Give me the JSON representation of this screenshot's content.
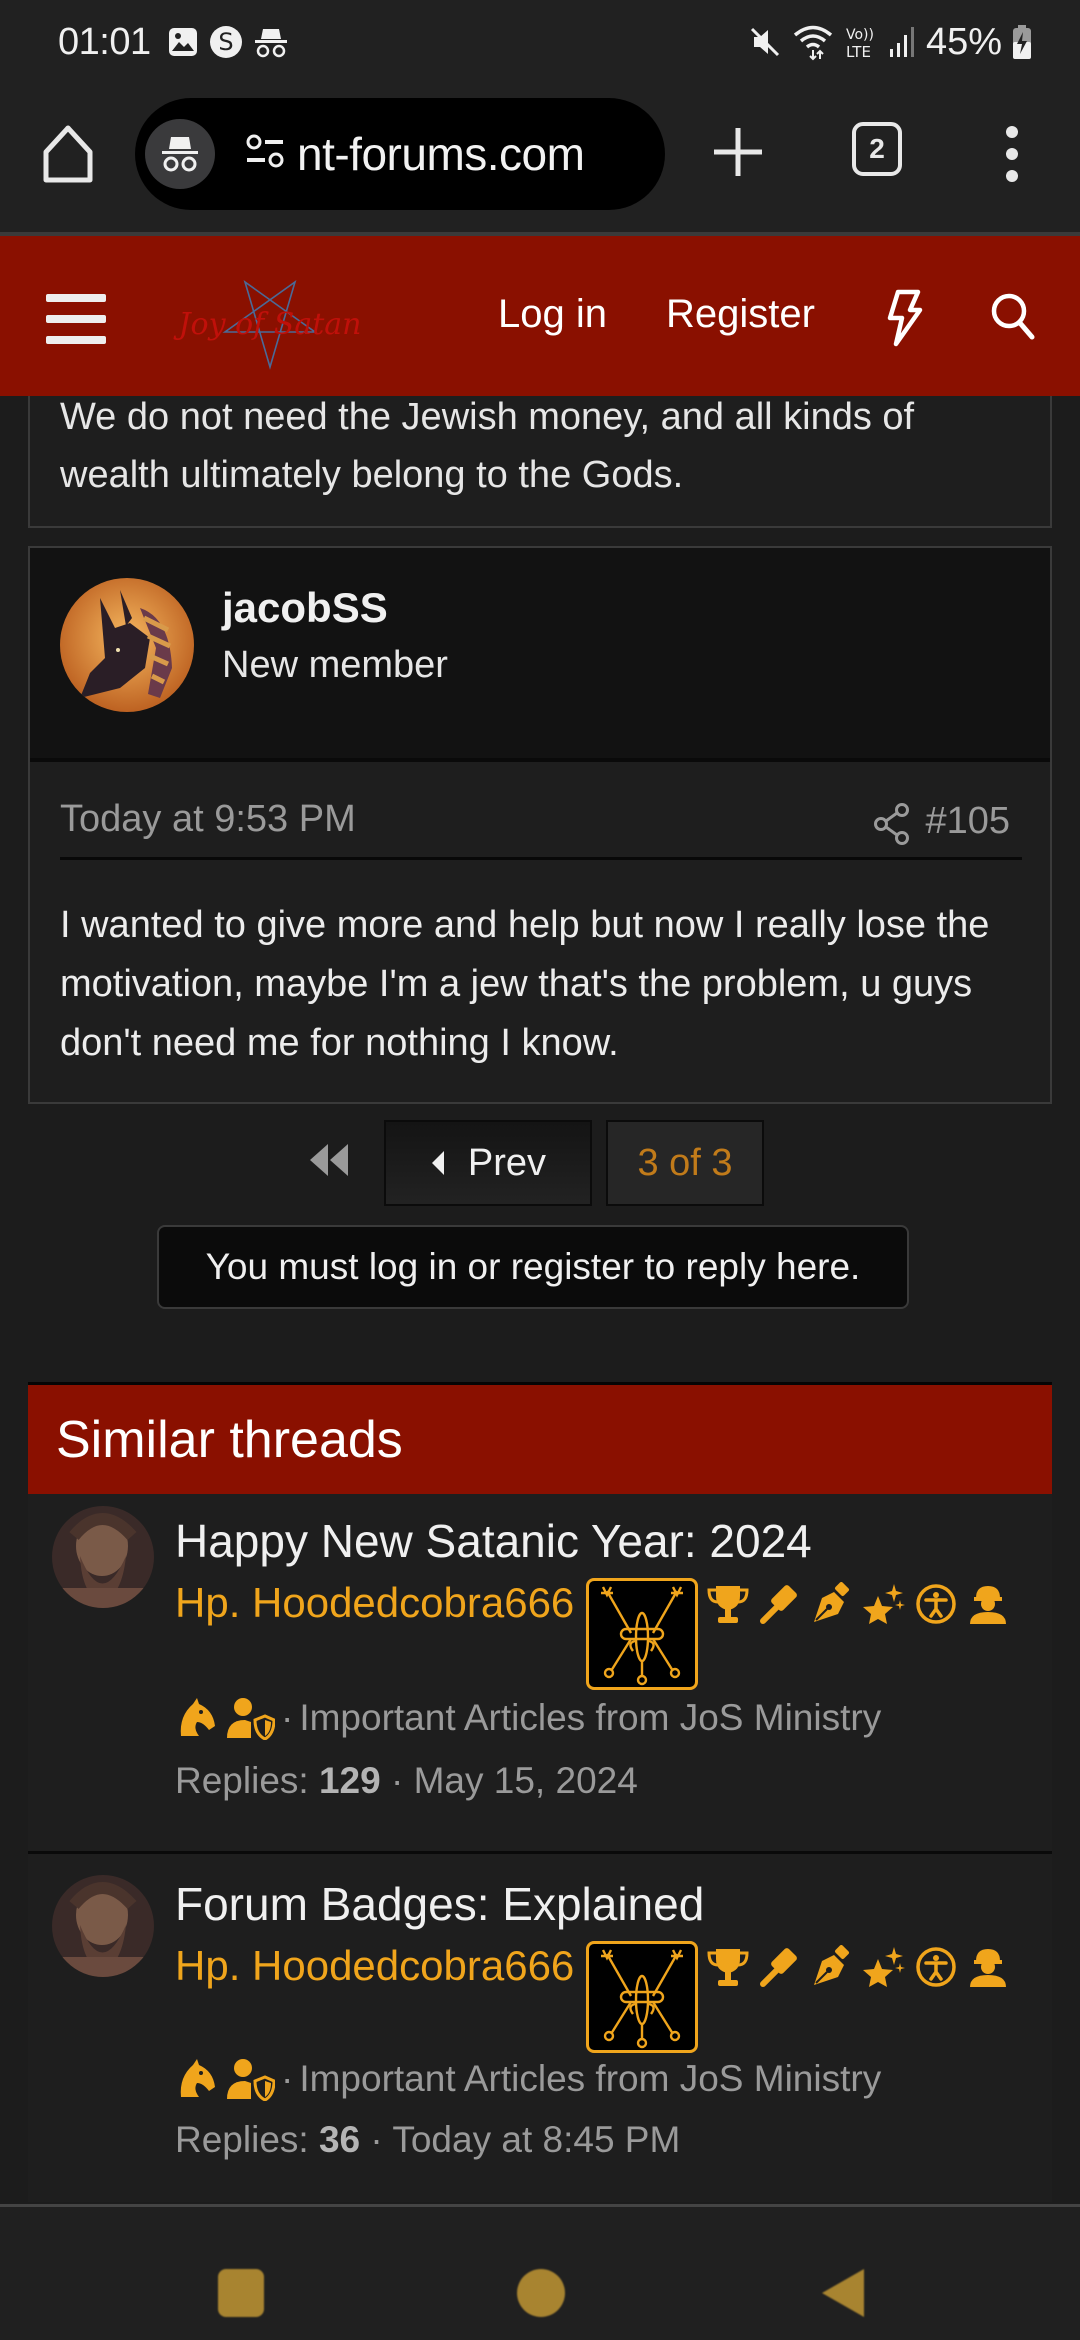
{
  "status_bar": {
    "time": "01:01",
    "battery_percent": "45%",
    "left_icons": [
      "gallery-icon",
      "s-circle-icon",
      "incognito-icon"
    ],
    "right_icons": [
      "mute-icon",
      "wifi-icon",
      "volte-lte-icon",
      "signal-icon",
      "battery-charging-icon"
    ]
  },
  "browser": {
    "url": "nt-forums.com",
    "tab_count": "2",
    "mode": "incognito"
  },
  "forum_header": {
    "logo_text": "Joy of Satan",
    "login_label": "Log in",
    "register_label": "Register",
    "brand_color": "#8a1000"
  },
  "previous_post": {
    "text_tail": "We do not need the Jewish money, and all kinds of wealth ultimately belong to the Gods."
  },
  "post": {
    "username": "jacobSS",
    "user_title": "New member",
    "date": "Today at 9:53 PM",
    "number": "#105",
    "body": "I wanted to give more and help but now I really lose the motivation, maybe I'm a jew that's the problem, u guys don't need me for nothing I know."
  },
  "pagination": {
    "prev_label": "Prev",
    "current": "3 of 3",
    "current_page": 3,
    "total_pages": 3
  },
  "reply_notice": "You must log in or register to reply here.",
  "similar_threads": {
    "heading": "Similar threads",
    "items": [
      {
        "title": "Happy New Satanic Year: 2024",
        "author": "Hp. Hoodedcobra666",
        "forum": "Important Articles from JoS Ministry",
        "replies_label": "Replies:",
        "replies": "129",
        "date": "May 15, 2024",
        "badges": [
          "sigil-badge",
          "trophy-icon",
          "gavel-icon",
          "pen-nib-icon",
          "sparkle-star-icon",
          "accessibility-icon",
          "worker-icon",
          "chess-knight-icon",
          "user-shield-icon"
        ]
      },
      {
        "title": "Forum Badges: Explained",
        "author": "Hp. Hoodedcobra666",
        "forum": "Important Articles from JoS Ministry",
        "replies_label": "Replies:",
        "replies": "36",
        "date": "Today at 8:45 PM",
        "badges": [
          "sigil-badge",
          "trophy-icon",
          "gavel-icon",
          "pen-nib-icon",
          "sparkle-star-icon",
          "accessibility-icon",
          "worker-icon",
          "chess-knight-icon",
          "user-shield-icon"
        ]
      }
    ]
  },
  "colors": {
    "accent_gold": "#f0a51c",
    "page_number_color": "#c17b1a",
    "nav_buttons": "#a88430"
  }
}
